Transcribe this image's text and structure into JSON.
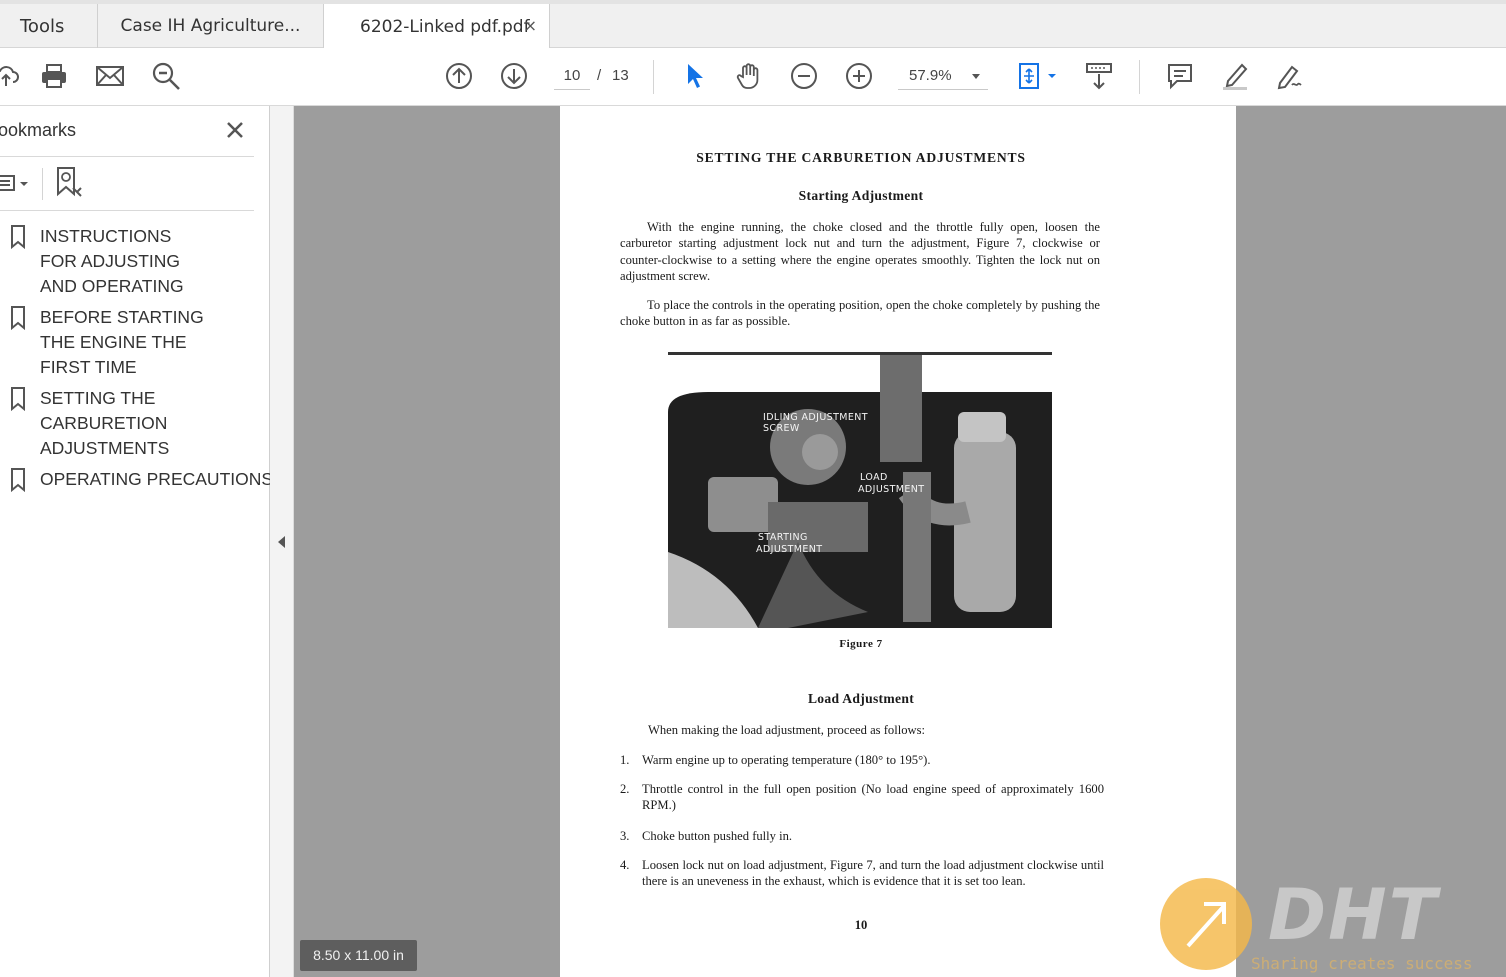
{
  "tabs": {
    "tools": "Tools",
    "case": "Case IH Agriculture...",
    "active": "6202-Linked pdf.pdf",
    "close_glyph": "×"
  },
  "toolbar": {
    "page_current": "10",
    "page_separator": "/",
    "page_total": "13",
    "zoom": "57.9%",
    "icons": [
      "upload-icon",
      "print-icon",
      "email-icon",
      "search-icon",
      "page-up-icon",
      "page-down-icon",
      "select-cursor-icon",
      "hand-icon",
      "zoom-out-icon",
      "zoom-in-icon",
      "fit-page-icon",
      "scroll-mode-icon",
      "comment-icon",
      "highlight-icon",
      "sign-icon"
    ]
  },
  "bookmarks": {
    "title": "ookmarks",
    "items": [
      {
        "label": "INSTRUCTIONS FOR ADJUSTING AND OPERATING"
      },
      {
        "label": "BEFORE STARTING THE ENGINE THE FIRST TIME"
      },
      {
        "label": "SETTING THE CARBURETION ADJUSTMENTS"
      },
      {
        "label": "OPERATING PRECAUTIONS"
      }
    ]
  },
  "document": {
    "title": "SETTING THE CARBURETION ADJUSTMENTS",
    "starting_heading": "Starting Adjustment",
    "para1": "With the engine running, the choke closed and the throttle fully open, loosen the carburetor starting adjustment lock nut and turn the adjustment, Figure 7, clockwise or counter-clockwise to a setting where the engine operates smoothly. Tighten the lock nut on adjustment screw.",
    "para2": "To place the controls in the operating position, open the choke completely by pushing the choke button in as far as possible.",
    "figure_labels": {
      "idling_1": "IDLING ADJUSTMENT",
      "idling_2": "SCREW",
      "load_1": "LOAD",
      "load_2": "ADJUSTMENT",
      "start_1": "STARTING",
      "start_2": "ADJUSTMENT"
    },
    "figure_caption": "Figure 7",
    "load_heading": "Load Adjustment",
    "load_intro": "When making the load adjustment, proceed as follows:",
    "steps": [
      {
        "num": "1.",
        "text": "Warm engine up to operating temperature (180° to 195°)."
      },
      {
        "num": "2.",
        "text": "Throttle control in the full open position (No load engine speed of approximately 1600 RPM.)"
      },
      {
        "num": "3.",
        "text": "Choke button pushed fully in."
      },
      {
        "num": "4.",
        "text": "Loosen lock nut on load adjustment, Figure 7, and turn the load adjustment clockwise until there is an uneveness in the exhaust, which is evidence that it is set too lean."
      }
    ],
    "page_number": "10"
  },
  "page_size": "8.50 x 11.00 in",
  "watermark": {
    "brand": "DHT",
    "tagline": "Sharing creates success"
  },
  "colors": {
    "accent_blue": "#1473e6",
    "doc_background": "#9d9d9d",
    "watermark_orange": "#f5b94a"
  }
}
